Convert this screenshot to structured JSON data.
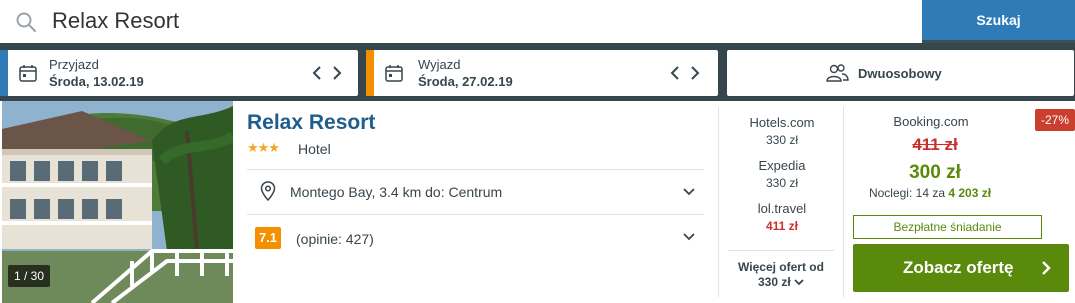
{
  "search": {
    "query": "Relax Resort",
    "button_label": "Szukaj"
  },
  "dates": {
    "checkin": {
      "label": "Przyjazd",
      "value": "Środa, 13.02.19",
      "stripe_color": "#2f7bb8"
    },
    "checkout": {
      "label": "Wyjazd",
      "value": "Środa, 27.02.19",
      "stripe_color": "#f48f00"
    }
  },
  "room": {
    "label": "Dwuosobowy"
  },
  "hotel": {
    "photo_counter": "1 / 30",
    "name": "Relax Resort",
    "stars": "★★★",
    "type": "Hotel",
    "location": "Montego Bay, 3.4 km do: Centrum",
    "rating": "7.1",
    "reviews": "(opinie: 427)"
  },
  "offers": [
    {
      "provider": "Hotels.com",
      "price": "330 zł",
      "highlight": false
    },
    {
      "provider": "Expedia",
      "price": "330 zł",
      "highlight": false
    },
    {
      "provider": "lol.travel",
      "price": "411 zł",
      "highlight": true
    }
  ],
  "more_offers": {
    "line1": "Więcej ofert od",
    "line2": "330 zł"
  },
  "best_deal": {
    "provider": "Booking.com",
    "discount": "-27%",
    "old_price": "411 zł",
    "price": "300 zł",
    "nights_prefix": "Noclegi: 14 za",
    "nights_total": "4 203 zł",
    "badge": "Bezpłatne śniadanie",
    "cta": "Zobacz ofertę"
  },
  "colors": {
    "brand_blue": "#2f7bb8",
    "accent_orange": "#f48f00",
    "deal_green": "#5a8a0b",
    "price_red": "#c9302c"
  }
}
